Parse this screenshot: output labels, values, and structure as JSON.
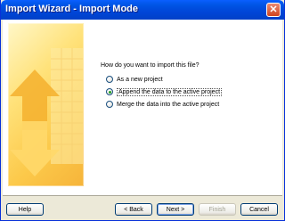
{
  "window": {
    "title": "Import Wizard - Import Mode",
    "close_symbol": "✕"
  },
  "main": {
    "question": "How do you want to import this file?",
    "options": [
      {
        "label": "As a new project",
        "selected": false
      },
      {
        "label": "Append the data to the active project",
        "selected": true
      },
      {
        "label": "Merge the data into the active project",
        "selected": false
      }
    ]
  },
  "buttons": {
    "help": "Help",
    "back": "< Back",
    "next": "Next >",
    "finish": "Finish",
    "cancel": "Cancel"
  },
  "colors": {
    "titlebar": "#0055e5",
    "dialog_bg": "#ece9d8",
    "side_image": "#fcc94a"
  }
}
